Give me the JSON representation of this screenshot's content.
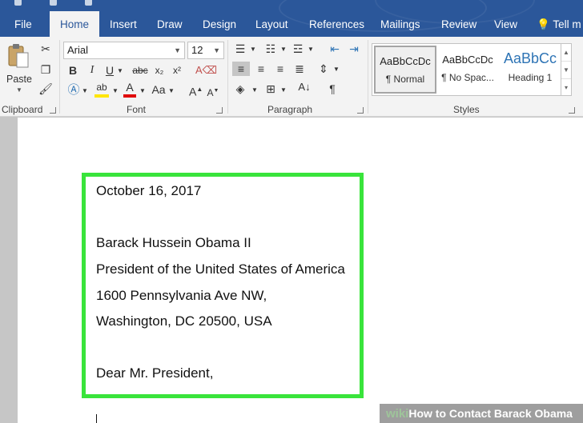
{
  "tabs": [
    {
      "label": "File",
      "active": false
    },
    {
      "label": "Home",
      "active": true
    },
    {
      "label": "Insert",
      "active": false
    },
    {
      "label": "Draw",
      "active": false
    },
    {
      "label": "Design",
      "active": false
    },
    {
      "label": "Layout",
      "active": false
    },
    {
      "label": "References",
      "active": false
    },
    {
      "label": "Mailings",
      "active": false
    },
    {
      "label": "Review",
      "active": false
    },
    {
      "label": "View",
      "active": false
    }
  ],
  "tell_me": "Tell m",
  "clipboard": {
    "paste_label": "Paste",
    "group_label": "Clipboard"
  },
  "font": {
    "family": "Arial",
    "size": "12",
    "group_label": "Font",
    "change_case": "Aa"
  },
  "paragraph": {
    "group_label": "Paragraph"
  },
  "styles": {
    "group_label": "Styles",
    "items": [
      {
        "sample": "AaBbCcDc",
        "name": "¶ Normal"
      },
      {
        "sample": "AaBbCcDc",
        "name": "¶ No Spac..."
      },
      {
        "sample": "AaBbCc",
        "name": "Heading 1"
      }
    ]
  },
  "document": {
    "lines": [
      "October 16, 2017",
      "Barack Hussein Obama II",
      "President of the United States of America",
      "1600 Pennsylvania Ave NW,",
      "Washington, DC 20500, USA",
      "Dear Mr. President,"
    ]
  },
  "highlight_color": "#39e43b",
  "accent_color": "#2b579a",
  "watermark": {
    "brand": "wiki",
    "title": "How to Contact Barack Obama"
  }
}
